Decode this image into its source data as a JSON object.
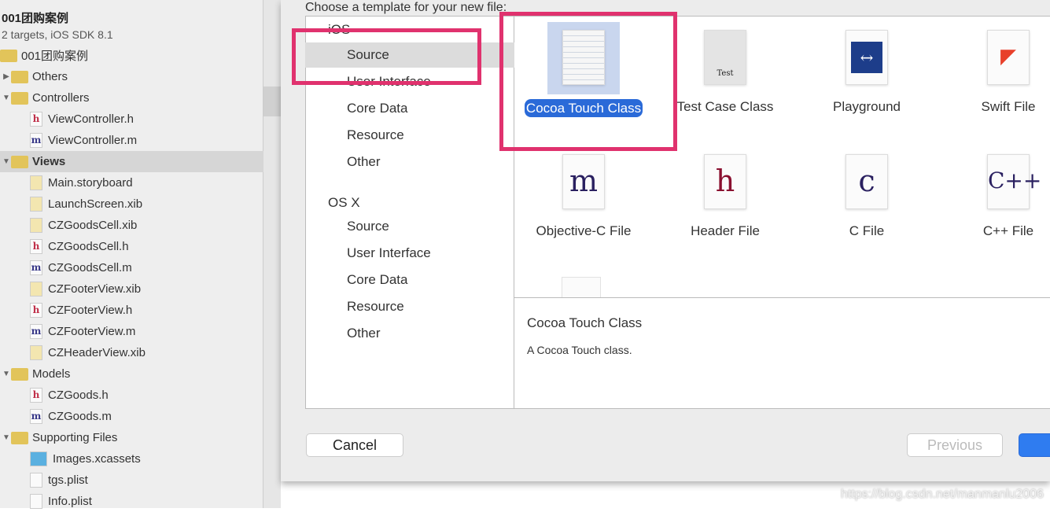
{
  "navigator": {
    "project_name": "001团购案例",
    "project_sub": "2 targets, iOS SDK 8.1",
    "rows": [
      {
        "label": "001团购案例",
        "type": "folder",
        "indent": 0,
        "tri": ""
      },
      {
        "label": "Others",
        "type": "folder",
        "indent": 1,
        "tri": "▶"
      },
      {
        "label": "Controllers",
        "type": "folder",
        "indent": 1,
        "tri": "▼"
      },
      {
        "label": "ViewController.h",
        "type": "h",
        "indent": 2
      },
      {
        "label": "ViewController.m",
        "type": "m",
        "indent": 2
      },
      {
        "label": "Views",
        "type": "folder",
        "indent": 1,
        "tri": "▼",
        "selected": true
      },
      {
        "label": "Main.storyboard",
        "type": "sb",
        "indent": 2
      },
      {
        "label": "LaunchScreen.xib",
        "type": "xib",
        "indent": 2
      },
      {
        "label": "CZGoodsCell.xib",
        "type": "xib",
        "indent": 2
      },
      {
        "label": "CZGoodsCell.h",
        "type": "h",
        "indent": 2
      },
      {
        "label": "CZGoodsCell.m",
        "type": "m",
        "indent": 2
      },
      {
        "label": "CZFooterView.xib",
        "type": "xib",
        "indent": 2
      },
      {
        "label": "CZFooterView.h",
        "type": "h",
        "indent": 2
      },
      {
        "label": "CZFooterView.m",
        "type": "m",
        "indent": 2
      },
      {
        "label": "CZHeaderView.xib",
        "type": "xib",
        "indent": 2
      },
      {
        "label": "Models",
        "type": "folder",
        "indent": 1,
        "tri": "▼"
      },
      {
        "label": "CZGoods.h",
        "type": "h",
        "indent": 2
      },
      {
        "label": "CZGoods.m",
        "type": "m",
        "indent": 2
      },
      {
        "label": "Supporting Files",
        "type": "folder",
        "indent": 1,
        "tri": "▼"
      },
      {
        "label": "Images.xcassets",
        "type": "assets",
        "indent": 2
      },
      {
        "label": "tgs.plist",
        "type": "plist",
        "indent": 2
      },
      {
        "label": "Info.plist",
        "type": "plist",
        "indent": 2
      }
    ]
  },
  "dialog": {
    "prompt": "Choose a template for your new file:",
    "sections": [
      {
        "title": "iOS",
        "items": [
          "Source",
          "User Interface",
          "Core Data",
          "Resource",
          "Other"
        ],
        "selected": 0
      },
      {
        "title": "OS X",
        "items": [
          "Source",
          "User Interface",
          "Core Data",
          "Resource",
          "Other"
        ]
      }
    ],
    "templates": [
      {
        "label": "Cocoa Touch Class",
        "glyph": "",
        "selected": true
      },
      {
        "label": "Test Case Class",
        "glyph": "Test"
      },
      {
        "label": "Playground",
        "glyph": "↔"
      },
      {
        "label": "Swift File",
        "glyph": "◤"
      },
      {
        "label": "Objective-C File",
        "glyph": "m"
      },
      {
        "label": "Header File",
        "glyph": "h"
      },
      {
        "label": "C File",
        "glyph": "c"
      },
      {
        "label": "C++ File",
        "glyph": "C++"
      }
    ],
    "description": {
      "title": "Cocoa Touch Class",
      "text": "A Cocoa Touch class."
    },
    "cancel": "Cancel",
    "previous": "Previous"
  },
  "watermark": "https://blog.csdn.net/manmanlu2006",
  "colors": {
    "highlight": "#e0326e",
    "accent": "#2a6ad8"
  }
}
